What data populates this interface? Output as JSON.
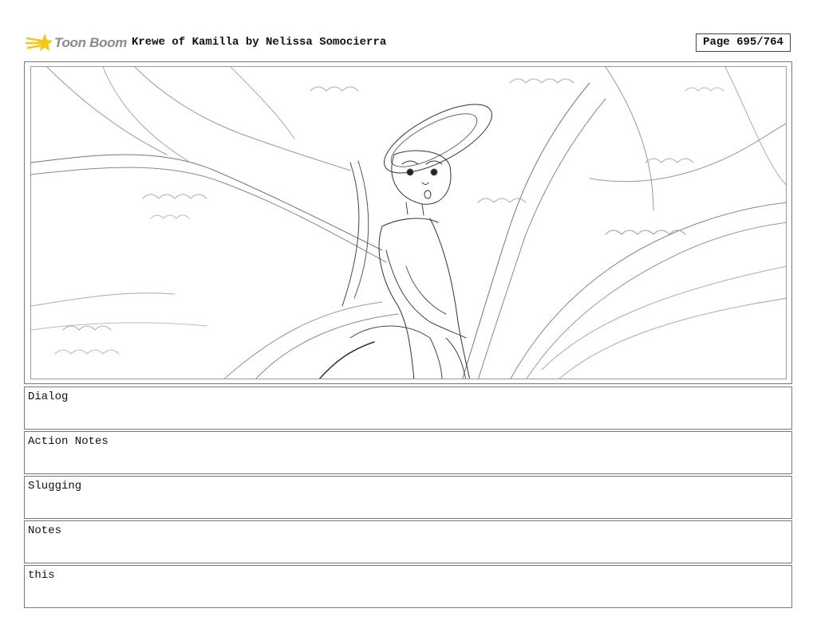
{
  "header": {
    "brand_name": "Toon Boom",
    "brand_logo_icon": "toon-boom-star-logo",
    "brand_color": "#f5c518",
    "title": "Krewe of Kamilla by Nelissa Somocierra",
    "page_label": "Page 695/764"
  },
  "panel": {
    "image_icon": "storyboard-sketch-woman-under-tree"
  },
  "fields": [
    {
      "label": "Dialog"
    },
    {
      "label": "Action Notes"
    },
    {
      "label": "Slugging"
    },
    {
      "label": "Notes"
    },
    {
      "label": "this"
    }
  ]
}
